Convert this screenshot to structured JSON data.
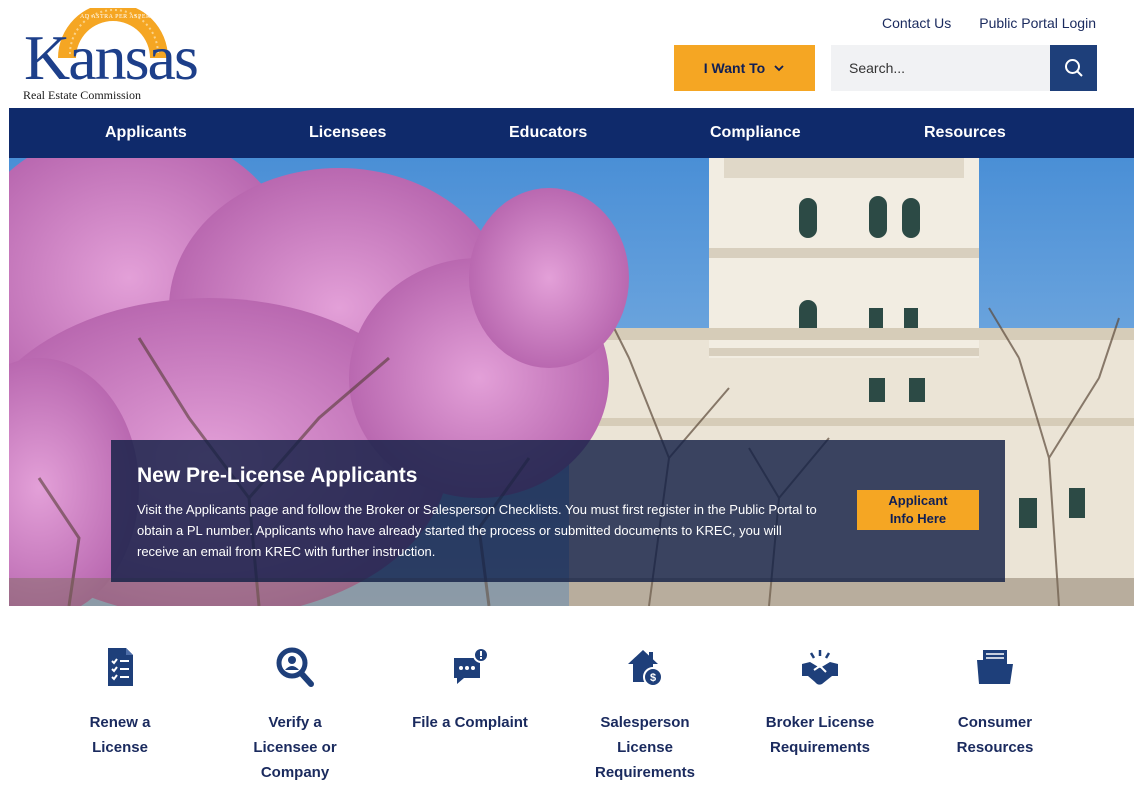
{
  "header": {
    "logo": {
      "word": "Kansas",
      "subtitle": "Real Estate Commission",
      "motto": "AD ASTRA PER ASPERA"
    },
    "top_links": [
      "Contact Us",
      "Public Portal Login"
    ],
    "i_want_label": "I Want To",
    "search_placeholder": "Search..."
  },
  "nav": {
    "items": [
      "Applicants",
      "Licensees",
      "Educators",
      "Compliance",
      "Resources"
    ]
  },
  "hero": {
    "title": "New Pre-License Applicants",
    "text": "Visit the Applicants page and follow the Broker or Salesperson Checklists. You must first register in the Public Portal to obtain a PL number. Applicants who have already started the process or submitted documents to KREC, you will receive an email from KREC with further instruction.",
    "cta_line1": "Applicant",
    "cta_line2": "Info Here"
  },
  "quick_links": [
    {
      "label": "Renew a License",
      "icon": "checklist-icon"
    },
    {
      "label": "Verify a Licensee or Company",
      "icon": "search-user-icon"
    },
    {
      "label": "File a Complaint",
      "icon": "chat-alert-icon"
    },
    {
      "label": "Salesperson License Requirements",
      "icon": "house-dollar-icon"
    },
    {
      "label": "Broker License Requirements",
      "icon": "handshake-icon"
    },
    {
      "label": "Consumer Resources",
      "icon": "folder-icon"
    }
  ],
  "colors": {
    "navy": "#0f2a6b",
    "accent": "#f5a623",
    "search_button": "#1e3f7a"
  }
}
